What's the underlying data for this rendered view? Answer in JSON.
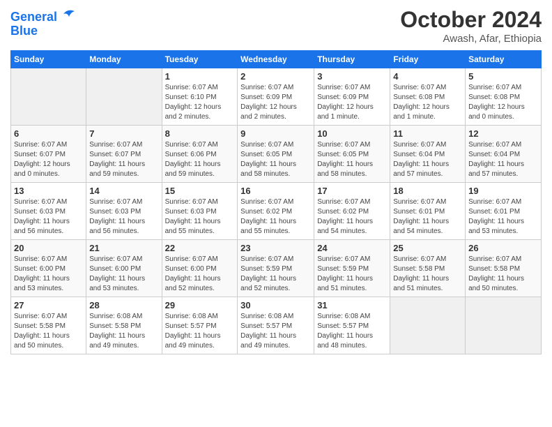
{
  "header": {
    "logo_line1": "General",
    "logo_line2": "Blue",
    "month_title": "October 2024",
    "location": "Awash, Afar, Ethiopia"
  },
  "days_of_week": [
    "Sunday",
    "Monday",
    "Tuesday",
    "Wednesday",
    "Thursday",
    "Friday",
    "Saturday"
  ],
  "weeks": [
    [
      {
        "day": "",
        "info": ""
      },
      {
        "day": "",
        "info": ""
      },
      {
        "day": "1",
        "info": "Sunrise: 6:07 AM\nSunset: 6:10 PM\nDaylight: 12 hours\nand 2 minutes."
      },
      {
        "day": "2",
        "info": "Sunrise: 6:07 AM\nSunset: 6:09 PM\nDaylight: 12 hours\nand 2 minutes."
      },
      {
        "day": "3",
        "info": "Sunrise: 6:07 AM\nSunset: 6:09 PM\nDaylight: 12 hours\nand 1 minute."
      },
      {
        "day": "4",
        "info": "Sunrise: 6:07 AM\nSunset: 6:08 PM\nDaylight: 12 hours\nand 1 minute."
      },
      {
        "day": "5",
        "info": "Sunrise: 6:07 AM\nSunset: 6:08 PM\nDaylight: 12 hours\nand 0 minutes."
      }
    ],
    [
      {
        "day": "6",
        "info": "Sunrise: 6:07 AM\nSunset: 6:07 PM\nDaylight: 12 hours\nand 0 minutes."
      },
      {
        "day": "7",
        "info": "Sunrise: 6:07 AM\nSunset: 6:07 PM\nDaylight: 11 hours\nand 59 minutes."
      },
      {
        "day": "8",
        "info": "Sunrise: 6:07 AM\nSunset: 6:06 PM\nDaylight: 11 hours\nand 59 minutes."
      },
      {
        "day": "9",
        "info": "Sunrise: 6:07 AM\nSunset: 6:05 PM\nDaylight: 11 hours\nand 58 minutes."
      },
      {
        "day": "10",
        "info": "Sunrise: 6:07 AM\nSunset: 6:05 PM\nDaylight: 11 hours\nand 58 minutes."
      },
      {
        "day": "11",
        "info": "Sunrise: 6:07 AM\nSunset: 6:04 PM\nDaylight: 11 hours\nand 57 minutes."
      },
      {
        "day": "12",
        "info": "Sunrise: 6:07 AM\nSunset: 6:04 PM\nDaylight: 11 hours\nand 57 minutes."
      }
    ],
    [
      {
        "day": "13",
        "info": "Sunrise: 6:07 AM\nSunset: 6:03 PM\nDaylight: 11 hours\nand 56 minutes."
      },
      {
        "day": "14",
        "info": "Sunrise: 6:07 AM\nSunset: 6:03 PM\nDaylight: 11 hours\nand 56 minutes."
      },
      {
        "day": "15",
        "info": "Sunrise: 6:07 AM\nSunset: 6:03 PM\nDaylight: 11 hours\nand 55 minutes."
      },
      {
        "day": "16",
        "info": "Sunrise: 6:07 AM\nSunset: 6:02 PM\nDaylight: 11 hours\nand 55 minutes."
      },
      {
        "day": "17",
        "info": "Sunrise: 6:07 AM\nSunset: 6:02 PM\nDaylight: 11 hours\nand 54 minutes."
      },
      {
        "day": "18",
        "info": "Sunrise: 6:07 AM\nSunset: 6:01 PM\nDaylight: 11 hours\nand 54 minutes."
      },
      {
        "day": "19",
        "info": "Sunrise: 6:07 AM\nSunset: 6:01 PM\nDaylight: 11 hours\nand 53 minutes."
      }
    ],
    [
      {
        "day": "20",
        "info": "Sunrise: 6:07 AM\nSunset: 6:00 PM\nDaylight: 11 hours\nand 53 minutes."
      },
      {
        "day": "21",
        "info": "Sunrise: 6:07 AM\nSunset: 6:00 PM\nDaylight: 11 hours\nand 53 minutes."
      },
      {
        "day": "22",
        "info": "Sunrise: 6:07 AM\nSunset: 6:00 PM\nDaylight: 11 hours\nand 52 minutes."
      },
      {
        "day": "23",
        "info": "Sunrise: 6:07 AM\nSunset: 5:59 PM\nDaylight: 11 hours\nand 52 minutes."
      },
      {
        "day": "24",
        "info": "Sunrise: 6:07 AM\nSunset: 5:59 PM\nDaylight: 11 hours\nand 51 minutes."
      },
      {
        "day": "25",
        "info": "Sunrise: 6:07 AM\nSunset: 5:58 PM\nDaylight: 11 hours\nand 51 minutes."
      },
      {
        "day": "26",
        "info": "Sunrise: 6:07 AM\nSunset: 5:58 PM\nDaylight: 11 hours\nand 50 minutes."
      }
    ],
    [
      {
        "day": "27",
        "info": "Sunrise: 6:07 AM\nSunset: 5:58 PM\nDaylight: 11 hours\nand 50 minutes."
      },
      {
        "day": "28",
        "info": "Sunrise: 6:08 AM\nSunset: 5:58 PM\nDaylight: 11 hours\nand 49 minutes."
      },
      {
        "day": "29",
        "info": "Sunrise: 6:08 AM\nSunset: 5:57 PM\nDaylight: 11 hours\nand 49 minutes."
      },
      {
        "day": "30",
        "info": "Sunrise: 6:08 AM\nSunset: 5:57 PM\nDaylight: 11 hours\nand 49 minutes."
      },
      {
        "day": "31",
        "info": "Sunrise: 6:08 AM\nSunset: 5:57 PM\nDaylight: 11 hours\nand 48 minutes."
      },
      {
        "day": "",
        "info": ""
      },
      {
        "day": "",
        "info": ""
      }
    ]
  ]
}
